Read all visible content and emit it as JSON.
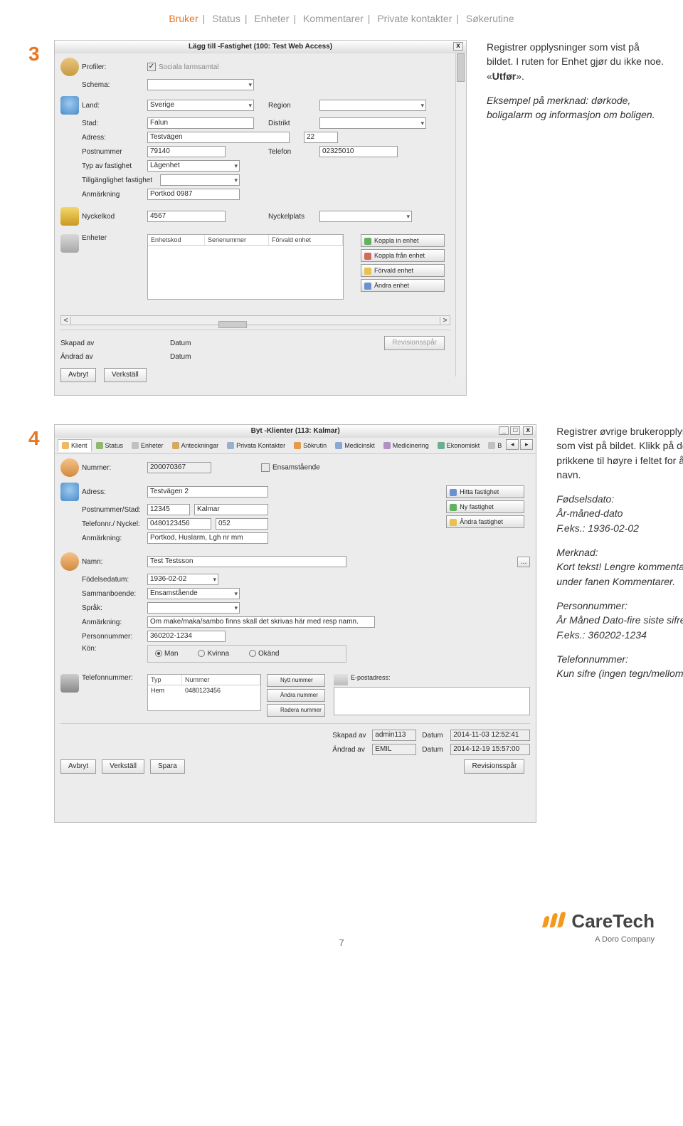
{
  "page_number": "7",
  "nav": {
    "items": [
      "Bruker",
      "Status",
      "Enheter",
      "Kommentarer",
      "Private kontakter",
      "Søkerutine"
    ],
    "active_index": 0
  },
  "step3": {
    "num": "3",
    "text1": "Registrer opplysninger som vist på bildet. I ruten for Enhet gjør du ikke noe. «",
    "bold": "Utfør",
    "text1b": "».",
    "text2": "Eksempel på merknad: dørkode, boligalarm og informasjon om boligen.",
    "win": {
      "title": "Lägg till -Fastighet (100: Test Web Access)",
      "x": "x",
      "profiler": "Profiler:",
      "profiler_v": "Sociala larmsamtal",
      "schema": "Schema:",
      "land": "Land:",
      "land_v": "Sverige",
      "region": "Region",
      "stad": "Stad:",
      "stad_v": "Falun",
      "distrikt": "Distrikt",
      "adress": "Adress:",
      "adress_v": "Testvägen",
      "adress_no": "22",
      "postnr": "Postnummer",
      "postnr_v": "79140",
      "telefon": "Telefon",
      "telefon_v": "02325010",
      "typ": "Typ av fastighet",
      "typ_v": "Lägenhet",
      "tillg": "Tillgänglighet fastighet",
      "anm": "Anmärkning",
      "anm_v": "Portkod 0987",
      "nyckelkod": "Nyckelkod",
      "nyckelkod_v": "4567",
      "nyckelplats": "Nyckelplats",
      "enheter": "Enheter",
      "cols": [
        "Enhetskod",
        "Serienummer",
        "Förvald enhet"
      ],
      "btns": [
        "Koppla in enhet",
        "Koppla från enhet",
        "Förvald enhet",
        "Ändra enhet"
      ],
      "skapad": "Skapad av",
      "andrad": "Ändrad av",
      "datum": "Datum",
      "revspar": "Revisionsspår",
      "avbryt": "Avbryt",
      "verkstall": "Verkställ"
    }
  },
  "step4": {
    "num": "4",
    "p1": "Registrer øvrige brukeropplysninger som vist på bildet. Klikk på de tre prikkene til høyre i feltet for å skrive navn.",
    "fd1": "Fødselsdato:",
    "fd2": "År-måned-dato",
    "fd3": "F.eks.: 1936-02-02",
    "mk1": "Merknad:",
    "mk2": "Kort tekst! Lengre kommentarer skrives under fanen Kommentarer.",
    "pn1": "Personnummer:",
    "pn2": "År Måned Dato-fire siste sifre",
    "pn3": "F.eks.: 360202-1234",
    "tn1": "Telefonnummer:",
    "tn2": "Kun sifre (ingen tegn/mellomrom)",
    "win": {
      "title": "Byt -Klienter (113: Kalmar)",
      "min": "_",
      "max": "□",
      "x": "x",
      "tabs": [
        "Klient",
        "Status",
        "Enheter",
        "Anteckningar",
        "Privata Kontakter",
        "Sökrutin",
        "Medicinskt",
        "Medicinering",
        "Ekonomiskt",
        "B"
      ],
      "nummer": "Nummer:",
      "nummer_v": "200070367",
      "ensam": "Ensamstående",
      "addr": "Adress:",
      "addr_v": "Testvägen 2",
      "pstad": "Postnummer/Stad:",
      "pstad_v1": "12345",
      "pstad_v2": "Kalmar",
      "tel": "Telefonnr./ Nyckel:",
      "tel_v1": "0480123456",
      "tel_v2": "052",
      "anm": "Anmärkning:",
      "anm_v": "Portkod, Huslarm, Lgh nr mm",
      "hitta": "Hitta fastighet",
      "ny": "Ny fastighet",
      "andra": "Ändra fastighet",
      "namn": "Namn:",
      "namn_v": "Test Testsson",
      "dots": "...",
      "fdat": "Födelsedatum:",
      "fdat_v": "1936-02-02",
      "samman": "Sammanboende:",
      "samman_v": "Ensamstående",
      "sprak": "Språk:",
      "anm2": "Anmärkning:",
      "anm2_v": "Om make/maka/sambo finns skall det skrivas här med resp namn.",
      "pnr": "Personnummer:",
      "pnr_v": "360202-1234",
      "kon": "Kön:",
      "man": "Man",
      "kvinna": "Kvinna",
      "okand": "Okänd",
      "telnum": "Telefonnummer:",
      "tcols": [
        "Typ",
        "Nummer"
      ],
      "trow1": [
        "Hem",
        "0480123456"
      ],
      "nytt": "Nytt nummer",
      "andranum": "Ändra nummer",
      "radera": "Radera nummer",
      "epost": "E-postadress:",
      "skapad": "Skapad av",
      "andrad": "Ändrad av",
      "datum": "Datum",
      "ska_v": "admin113",
      "and_v": "EMIL",
      "d1": "2014-11-03 12:52:41",
      "d2": "2014-12-19 15:57:00",
      "revspar": "Revisionsspår",
      "avbryt": "Avbryt",
      "verkstall": "Verkställ",
      "spara": "Spara"
    }
  },
  "logo": {
    "name": "CareTech",
    "sub": "A Doro Company"
  }
}
